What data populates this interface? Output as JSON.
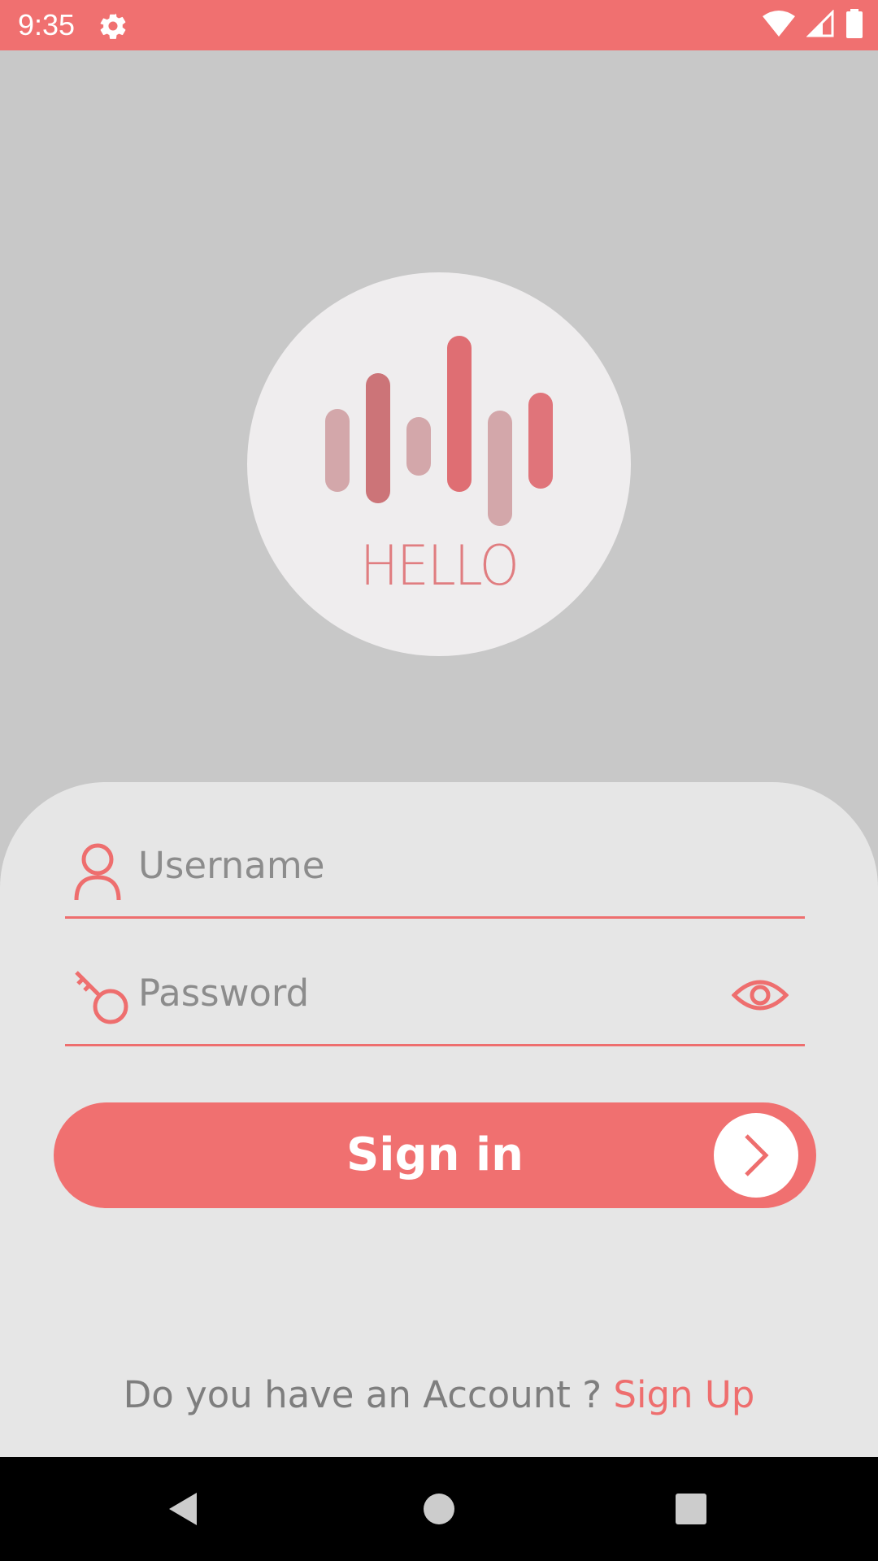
{
  "status_bar": {
    "time": "9:35",
    "background_color": "#f07070",
    "left_icons": [
      "settings-gear-icon"
    ],
    "right_icons": [
      "wifi-icon",
      "cellular-signal-icon",
      "battery-icon"
    ]
  },
  "logo": {
    "text": "HELLO",
    "icon": "sound-wave-bars-icon"
  },
  "form": {
    "username": {
      "placeholder": "Username",
      "value": "",
      "icon": "user-icon"
    },
    "password": {
      "placeholder": "Password",
      "value": "",
      "icon": "key-icon",
      "toggle_icon": "eye-icon"
    },
    "signin_label": "Sign in",
    "signin_icon": "chevron-right-icon"
  },
  "footer": {
    "account_prompt": "Do you have an Account ?",
    "signup_label": "Sign Up"
  },
  "nav_bar": {
    "buttons": [
      "back-triangle-icon",
      "home-circle-icon",
      "recents-square-icon"
    ]
  },
  "colors": {
    "accent": "#f07070",
    "background_top": "#c8c8c8",
    "card": "#e6e6e6",
    "logo_circle": "#efedee",
    "placeholder_text": "#8c8c8c"
  }
}
